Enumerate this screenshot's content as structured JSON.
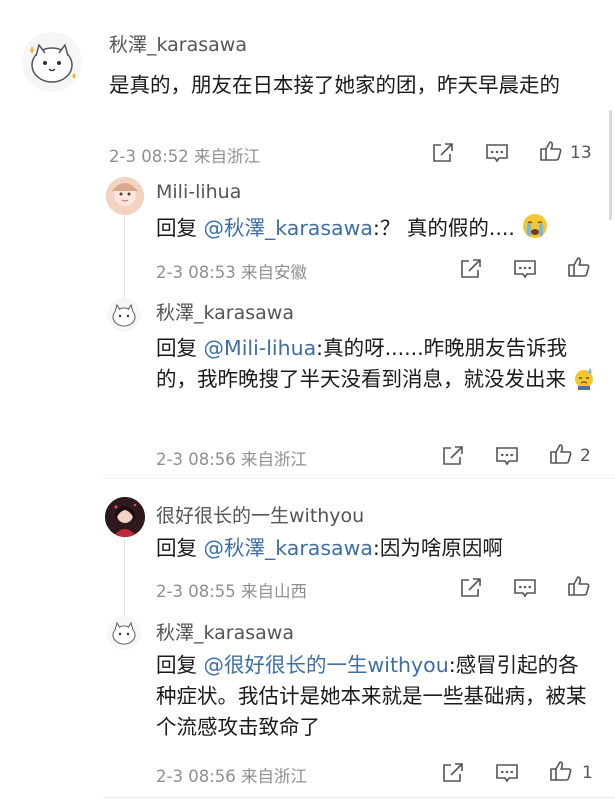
{
  "comments": [
    {
      "user": "秋澤_karasawa",
      "text": "是真的，朋友在日本接了她家的团，昨天早晨走的",
      "meta": "2-3 08:52 来自浙江",
      "likes": "13"
    },
    {
      "user": "Mili-lihua",
      "reply_prefix": "回复 ",
      "mention": "@秋澤_karasawa",
      "text": ":？ 真的假的....",
      "emoji": "crying-face",
      "meta": "2-3 08:53 来自安徽",
      "likes": ""
    },
    {
      "user": "秋澤_karasawa",
      "reply_prefix": "回复 ",
      "mention": "@Mili-lihua",
      "text": ":真的呀......昨晚朋友告诉我的，我昨晚搜了半天没看到消息，就没发出来",
      "emoji": "sweat-face",
      "meta": "2-3 08:56 来自浙江",
      "likes": "2"
    },
    {
      "user": "很好很长的一生withyou",
      "reply_prefix": "回复 ",
      "mention": "@秋澤_karasawa",
      "text": ":因为啥原因啊",
      "meta": "2-3 08:55 来自山西",
      "likes": ""
    },
    {
      "user": "秋澤_karasawa",
      "reply_prefix": "回复 ",
      "mention": "@很好很长的一生withyou",
      "text": ":感冒引起的各种症状。我估计是她本来就是一些基础病，被某个流感攻击致命了",
      "meta": "2-3 08:56 来自浙江",
      "likes": "1"
    }
  ],
  "colors": {
    "mention": "#3e6ea8",
    "meta": "#8f8f8f",
    "text": "#1a1a1a"
  },
  "icons": [
    "share-icon",
    "comment-icon",
    "like-icon"
  ]
}
